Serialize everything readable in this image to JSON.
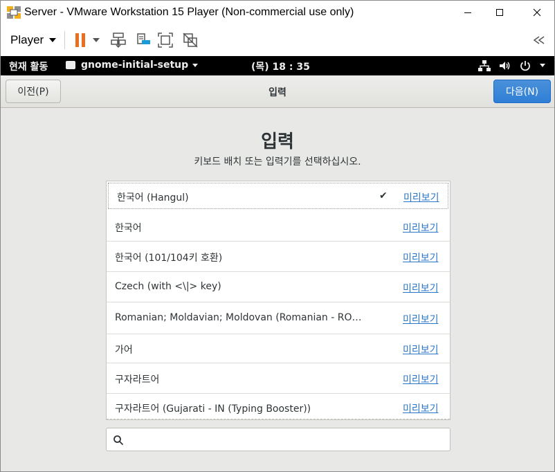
{
  "window": {
    "title": "Server - VMware Workstation 15 Player (Non-commercial use only)"
  },
  "vm_toolbar": {
    "player_label": "Player",
    "icons": [
      "pause-icon",
      "dropdown-caret-icon",
      "send-ctrl-alt-del-icon",
      "removable-devices-icon",
      "fullscreen-icon",
      "unity-icon",
      "collapse-icon"
    ]
  },
  "gnome_bar": {
    "activities": "현재 활동",
    "app_name": "gnome-initial-setup",
    "clock": "(목) 18 : 35",
    "tray_icons": [
      "network-icon",
      "volume-icon",
      "power-icon"
    ]
  },
  "header": {
    "prev_label": "이전(P)",
    "title": "입력",
    "next_label": "다음(N)"
  },
  "main": {
    "title": "입력",
    "subtitle": "키보드 배치 또는 입력기를 선택하십시오.",
    "preview_label": "미리보기",
    "check_mark": "✔",
    "layouts": [
      {
        "label": "한국어 (Hangul)",
        "selected": true
      },
      {
        "label": "한국어",
        "selected": false
      },
      {
        "label": "한국어 (101/104키 호환)",
        "selected": false
      },
      {
        "label": "Czech (with <\\|> key)",
        "selected": false
      },
      {
        "label": "Romanian; Moldavian; Moldovan (Romanian - RO (Typi⋯",
        "selected": false
      },
      {
        "label": "가어",
        "selected": false
      },
      {
        "label": "구자라트어",
        "selected": false
      },
      {
        "label": "구자라트어 (Gujarati - IN (Typing Booster))",
        "selected": false
      }
    ],
    "search": {
      "value": "",
      "placeholder": ""
    }
  },
  "colors": {
    "accent": "#2f7fd6",
    "link": "#2a76c6",
    "pause": "#e8701e",
    "content_bg": "#e8e8e7"
  }
}
